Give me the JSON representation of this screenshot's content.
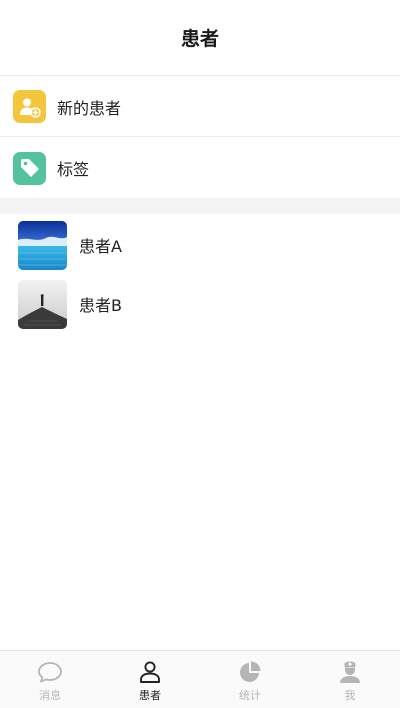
{
  "header": {
    "title": "患者"
  },
  "menu": [
    {
      "label": "新的患者",
      "icon": "add-user-icon",
      "color": "#f3c63b"
    },
    {
      "label": "标签",
      "icon": "tag-icon",
      "color": "#53c39d"
    }
  ],
  "patients": [
    {
      "name": "患者A",
      "avatar": "ocean-photo"
    },
    {
      "name": "患者B",
      "avatar": "pier-photo"
    }
  ],
  "tabbar": {
    "active": 1,
    "active_color": "#222222",
    "inactive_color": "#b5b5b5",
    "tabs": [
      {
        "label": "消息",
        "icon": "chat-bubble-icon"
      },
      {
        "label": "患者",
        "icon": "user-icon"
      },
      {
        "label": "统计",
        "icon": "pie-chart-icon"
      },
      {
        "label": "我",
        "icon": "doctor-icon"
      }
    ]
  }
}
